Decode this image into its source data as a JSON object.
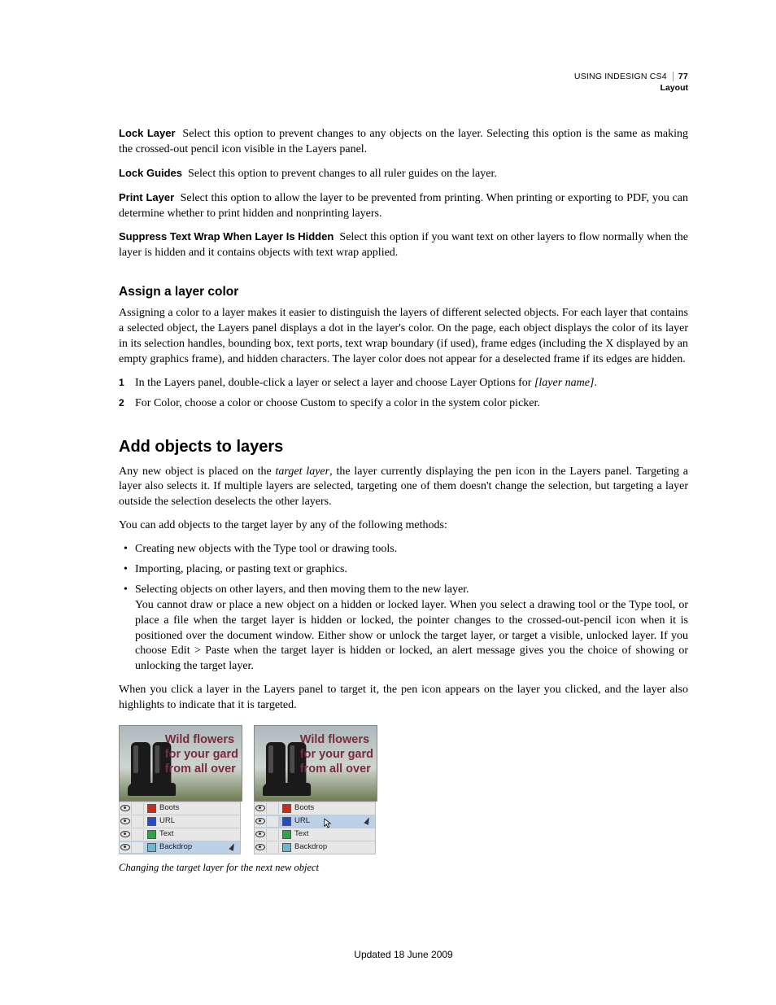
{
  "header": {
    "doc_title": "USING INDESIGN CS4",
    "section": "Layout",
    "page_number": "77"
  },
  "definitions": [
    {
      "term": "Lock Layer",
      "desc": "Select this option to prevent changes to any objects on the layer. Selecting this option is the same as making the crossed-out pencil icon visible in the Layers panel."
    },
    {
      "term": "Lock Guides",
      "desc": "Select this option to prevent changes to all ruler guides on the layer."
    },
    {
      "term": "Print Layer",
      "desc": "Select this option to allow the layer to be prevented from printing. When printing or exporting to PDF, you can determine whether to print hidden and nonprinting layers."
    },
    {
      "term": "Suppress Text Wrap When Layer Is Hidden",
      "desc": "Select this option if you want text on other layers to flow normally when the layer is hidden and it contains objects with text wrap applied."
    }
  ],
  "section_assign": {
    "heading": "Assign a layer color",
    "para": "Assigning a color to a layer makes it easier to distinguish the layers of different selected objects. For each layer that contains a selected object, the Layers panel displays a dot in the layer's color. On the page, each object displays the color of its layer in its selection handles, bounding box, text ports, text wrap boundary (if used), frame edges (including the X displayed by an empty graphics frame), and hidden characters. The layer color does not appear for a deselected frame if its edges are hidden.",
    "steps": [
      {
        "num": "1",
        "pre": "In the Layers panel, double-click a layer or select a layer and choose Layer Options for ",
        "em": "[layer name]",
        "post": "."
      },
      {
        "num": "2",
        "pre": "For Color, choose a color or choose Custom to specify a color in the system color picker.",
        "em": "",
        "post": ""
      }
    ]
  },
  "section_add": {
    "heading": "Add objects to layers",
    "para1_pre": "Any new object is placed on the ",
    "para1_em": "target layer",
    "para1_post": ", the layer currently displaying the pen icon in the Layers panel. Targeting a layer also selects it. If multiple layers are selected, targeting one of them doesn't change the selection, but targeting a layer outside the selection deselects the other layers.",
    "para2": "You can add objects to the target layer by any of the following methods:",
    "bullets": [
      "Creating new objects with the Type tool or drawing tools.",
      "Importing, placing, or pasting text or graphics.",
      "Selecting objects on other layers, and then moving them to the new layer."
    ],
    "indent": "You cannot draw or place a new object on a hidden or locked layer. When you select a drawing tool or the Type tool, or place a file when the target layer is hidden or locked, the pointer changes to the crossed-out-pencil icon when it is positioned over the document window. Either show or unlock the target layer, or target a visible, unlocked layer. If you choose Edit > Paste when the target layer is hidden or locked, an alert message gives you the choice of showing or unlocking the target layer.",
    "para3": "When you click a layer in the Layers panel to target it, the pen icon appears on the layer you clicked, and the layer also highlights to indicate that it is targeted."
  },
  "figure": {
    "headline_l1": "Wild flowers",
    "headline_l2": "for your gard",
    "headline_l3": "from all over",
    "layers": [
      {
        "name": "Boots",
        "color": "#c62d1c"
      },
      {
        "name": "URL",
        "color": "#2a49c6"
      },
      {
        "name": "Text",
        "color": "#2fa34a"
      },
      {
        "name": "Backdrop",
        "color": "#6fb7c9"
      }
    ],
    "left_active_index": 3,
    "right_active_index": 1,
    "caption": "Changing the target layer for the next new object"
  },
  "footer": "Updated 18 June 2009"
}
